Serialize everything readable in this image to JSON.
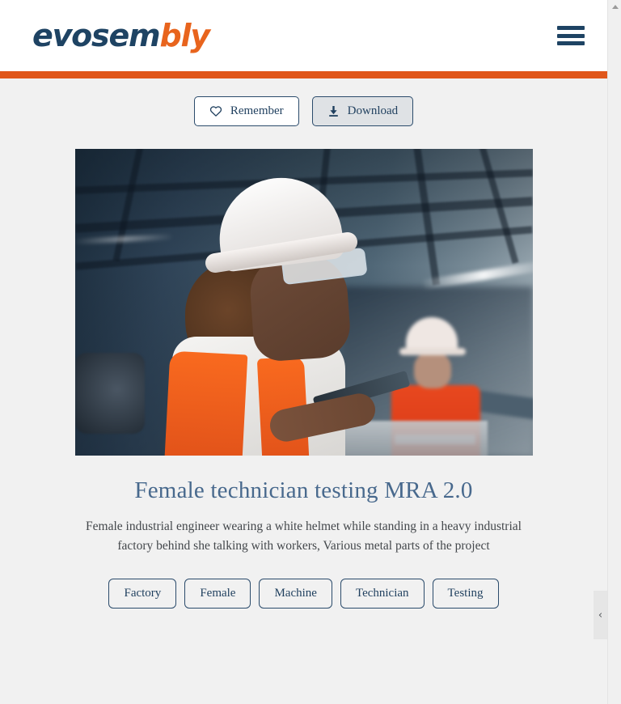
{
  "brand": {
    "logo_primary": "evosem",
    "logo_accent": "bly",
    "primary_color": "#1e4363",
    "accent_color": "#e8641d",
    "rule_color": "#e0561a"
  },
  "header": {
    "menu_icon": "hamburger-menu-icon"
  },
  "actions": {
    "remember": {
      "label": "Remember",
      "icon": "heart-outline-icon"
    },
    "download": {
      "label": "Download",
      "icon": "download-icon"
    }
  },
  "media": {
    "alt": "Female industrial engineer in white helmet and orange safety vest holding a tablet in a factory, second worker in background"
  },
  "asset": {
    "title": "Female technician testing MRA 2.0",
    "description": "Female industrial engineer wearing a white helmet while standing in a heavy industrial factory behind she talking with workers, Various metal parts of the project",
    "tags": [
      {
        "label": "Factory"
      },
      {
        "label": "Female"
      },
      {
        "label": "Machine"
      },
      {
        "label": "Technician"
      },
      {
        "label": "Testing"
      }
    ]
  },
  "chrome": {
    "scroll_up_arrow": "triangle-up-icon",
    "collapse_handle": "‹"
  }
}
